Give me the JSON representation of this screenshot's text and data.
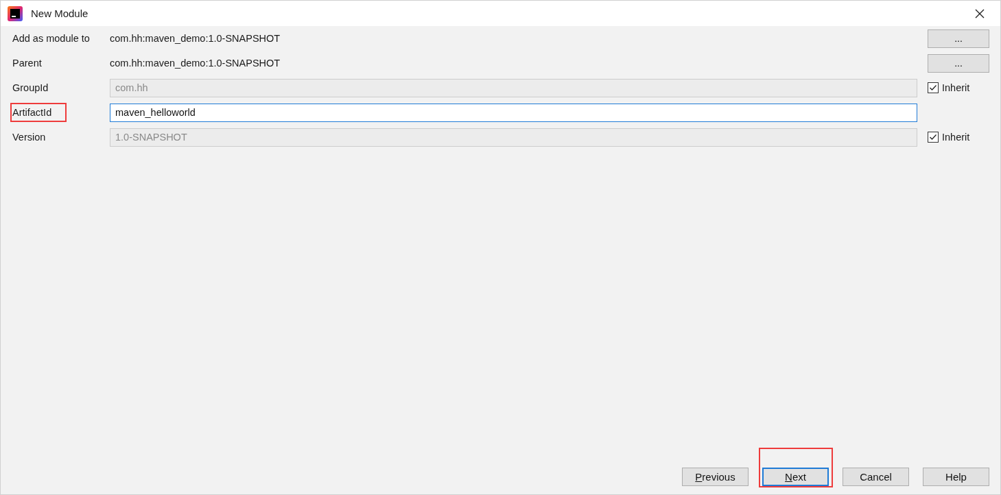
{
  "window": {
    "title": "New Module"
  },
  "rows": [
    {
      "kind": "text",
      "label": "Add as module to",
      "value": "com.hh:maven_demo:1.0-SNAPSHOT",
      "button": "...",
      "highlighted": false
    },
    {
      "kind": "text",
      "label": "Parent",
      "value": "com.hh:maven_demo:1.0-SNAPSHOT",
      "button": "...",
      "highlighted": false
    },
    {
      "kind": "field",
      "label": "GroupId",
      "value": "com.hh",
      "disabled": true,
      "inherit": {
        "label": "Inherit",
        "checked": true
      },
      "highlighted": false
    },
    {
      "kind": "field",
      "label": "ArtifactId",
      "value": "maven_helloworld",
      "disabled": false,
      "highlighted": true
    },
    {
      "kind": "field",
      "label": "Version",
      "value": "1.0-SNAPSHOT",
      "disabled": true,
      "inherit": {
        "label": "Inherit",
        "checked": true
      },
      "highlighted": false
    }
  ],
  "buttons": [
    {
      "mnemonic": "P",
      "rest": "revious",
      "default": false,
      "highlighted": false
    },
    {
      "mnemonic": "N",
      "rest": "ext",
      "default": true,
      "highlighted": true
    },
    {
      "rest": "Cancel",
      "default": false,
      "highlighted": false
    },
    {
      "rest": "Help",
      "default": false,
      "highlighted": false
    }
  ]
}
